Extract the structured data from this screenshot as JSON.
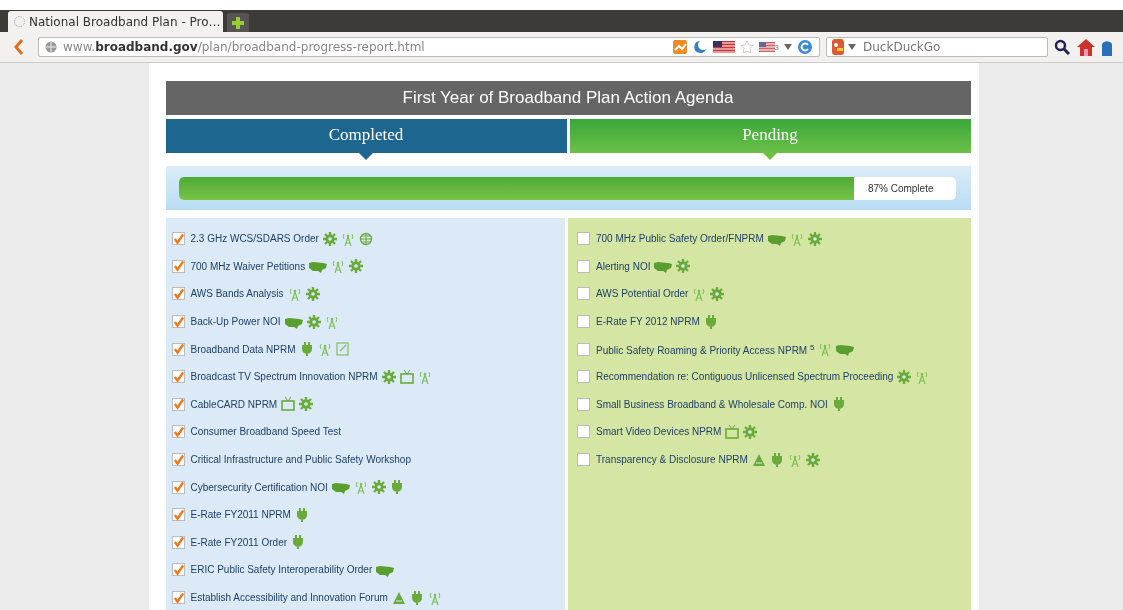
{
  "browser": {
    "tab_title": "National Broadband Plan - Pro…",
    "url_host_prefix": "www.",
    "url_host": "broadband.gov",
    "url_path": "/plan/broadband-progress-report.html",
    "flag_badge": "3",
    "search_placeholder": "DuckDuckGo"
  },
  "header": {
    "title": "First Year of Broadband Plan Action Agenda"
  },
  "progress": {
    "level": 0.87,
    "label": "87% Complete"
  },
  "columns": [
    {
      "heading": "Completed",
      "items": [
        {
          "label": "2.3 GHz WCS/SDARS Order",
          "checked": true,
          "icons": [
            {
              "kind": "gear"
            },
            {
              "kind": "antenna"
            },
            {
              "kind": "globe"
            }
          ]
        },
        {
          "label": "700 MHz Waiver Petitions",
          "checked": true,
          "icons": [
            {
              "kind": "map"
            },
            {
              "kind": "antenna"
            },
            {
              "kind": "gear"
            }
          ]
        },
        {
          "label": "AWS Bands Analysis",
          "checked": true,
          "icons": [
            {
              "kind": "antenna"
            },
            {
              "kind": "gear"
            }
          ]
        },
        {
          "label": "Back-Up Power NOI",
          "checked": true,
          "icons": [
            {
              "kind": "map"
            },
            {
              "kind": "gear"
            },
            {
              "kind": "antenna"
            }
          ]
        },
        {
          "label": "Broadband Data NPRM",
          "checked": true,
          "icons": [
            {
              "kind": "plug"
            },
            {
              "kind": "antenna"
            },
            {
              "kind": "note"
            }
          ]
        },
        {
          "label": "Broadcast TV Spectrum Innovation NPRM",
          "checked": true,
          "icons": [
            {
              "kind": "gear"
            },
            {
              "kind": "tv"
            },
            {
              "kind": "antenna"
            }
          ]
        },
        {
          "label": "CableCARD NPRM",
          "checked": true,
          "icons": [
            {
              "kind": "tv"
            },
            {
              "kind": "gear"
            }
          ]
        },
        {
          "label": "Consumer Broadband Speed Test",
          "checked": true
        },
        {
          "label": "Critical Infrastructure and Public Safety Workshop",
          "checked": true
        },
        {
          "label": "Cybersecurity Certification NOI",
          "checked": true,
          "icons": [
            {
              "kind": "map"
            },
            {
              "kind": "antenna"
            },
            {
              "kind": "gear"
            },
            {
              "kind": "plug"
            }
          ]
        },
        {
          "label": "E-Rate FY2011 NPRM",
          "checked": true,
          "icons": [
            {
              "kind": "plug"
            }
          ]
        },
        {
          "label": "E-Rate FY2011 Order",
          "checked": true,
          "icons": [
            {
              "kind": "plug"
            }
          ]
        },
        {
          "label": "ERIC Public Safety Interoperability Order",
          "checked": true,
          "icons": [
            {
              "kind": "map"
            }
          ]
        },
        {
          "label": "Establish Accessibility and Innovation Forum",
          "checked": true,
          "icons": [
            {
              "kind": "triangle"
            },
            {
              "kind": "plug"
            },
            {
              "kind": "antenna"
            }
          ]
        }
      ]
    },
    {
      "heading": "Pending",
      "items": [
        {
          "label": "700 MHz Public Safety Order/FNPRM",
          "checked": false,
          "icons": [
            {
              "kind": "map"
            },
            {
              "kind": "antenna"
            },
            {
              "kind": "gear"
            }
          ]
        },
        {
          "label": "Alerting NOI",
          "checked": false,
          "icons": [
            {
              "kind": "map"
            },
            {
              "kind": "gear"
            }
          ]
        },
        {
          "label": "AWS Potential Order",
          "checked": false,
          "icons": [
            {
              "kind": "antenna"
            },
            {
              "kind": "gear"
            }
          ]
        },
        {
          "label": "E-Rate FY 2012 NPRM",
          "checked": false,
          "icons": [
            {
              "kind": "plug"
            }
          ]
        },
        {
          "label": "Public Safety Roaming & Priority Access NPRM $^{5}$",
          "checked": false,
          "icons": [
            {
              "kind": "antenna"
            },
            {
              "kind": "map"
            }
          ]
        },
        {
          "label": "Recommendation re: Contiguous Unlicensed Spectrum Proceeding",
          "checked": false,
          "icons": [
            {
              "kind": "gear"
            },
            {
              "kind": "antenna"
            }
          ]
        },
        {
          "label": "Small Business Broadband & Wholesale Comp. NOI",
          "checked": false,
          "icons": [
            {
              "kind": "plug"
            }
          ]
        },
        {
          "label": "Smart Video Devices NPRM",
          "checked": false,
          "icons": [
            {
              "kind": "tv"
            },
            {
              "kind": "gear"
            }
          ]
        },
        {
          "label": "Transparency & Disclosure NPRM",
          "checked": false,
          "icons": [
            {
              "kind": "triangle"
            },
            {
              "kind": "plug"
            },
            {
              "kind": "antenna"
            },
            {
              "kind": "gear"
            }
          ]
        }
      ]
    }
  ]
}
